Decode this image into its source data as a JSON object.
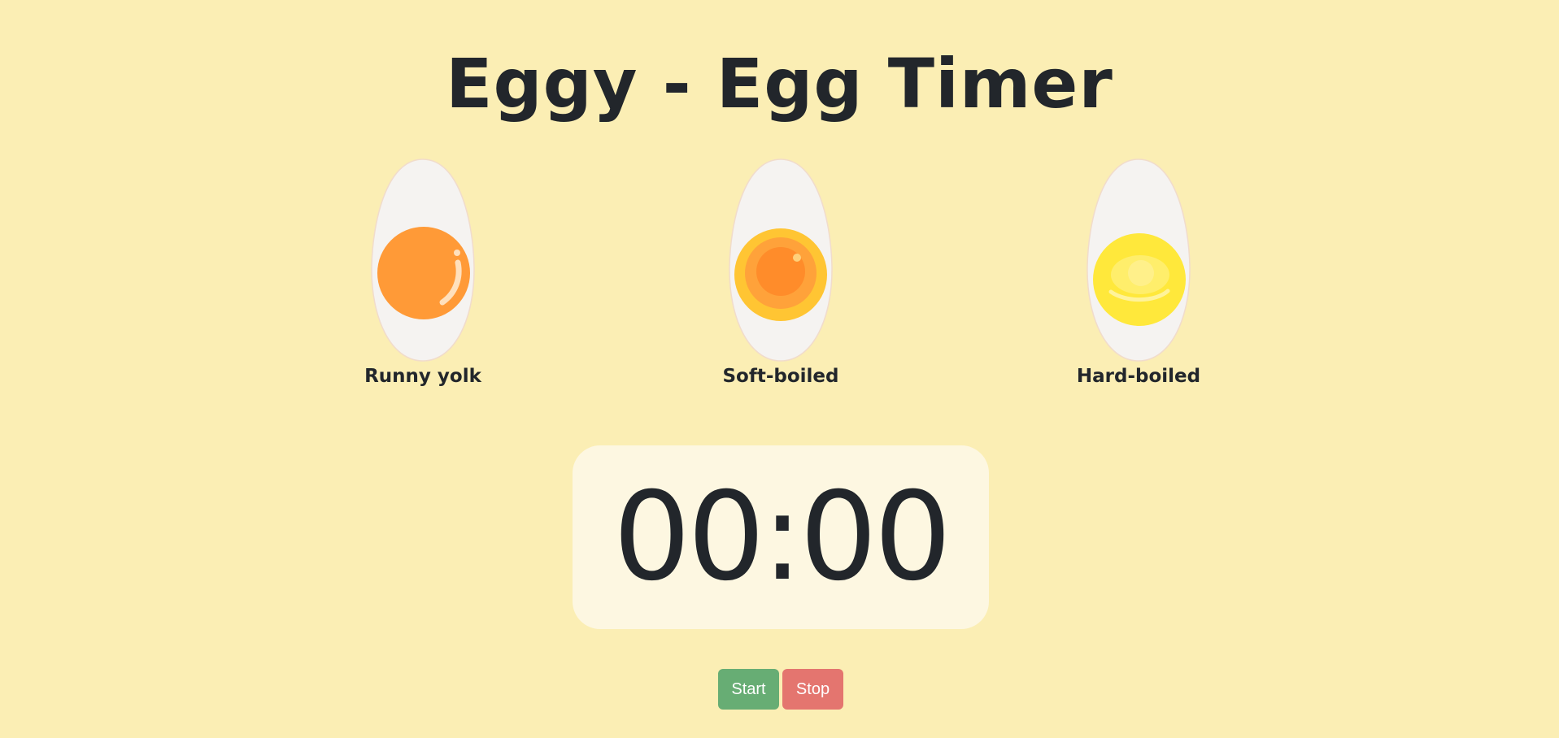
{
  "header": {
    "title": "Eggy - Egg Timer"
  },
  "eggs": [
    {
      "label": "Runny yolk",
      "icon": "runny-yolk-egg-icon",
      "yolk_color": "#FF9A37"
    },
    {
      "label": "Soft-boiled",
      "icon": "soft-boiled-egg-icon",
      "yolk_color": "#FFC533"
    },
    {
      "label": "Hard-boiled",
      "icon": "hard-boiled-egg-icon",
      "yolk_color": "#FFE83B"
    }
  ],
  "timer": {
    "display": "00:00"
  },
  "controls": {
    "start_label": "Start",
    "stop_label": "Stop"
  },
  "colors": {
    "background": "#FBEEB4",
    "timer_panel": "#FDF7E1",
    "text": "#22262B",
    "egg_white": "#F5F3F1",
    "start_button": "#67AD74",
    "stop_button": "#E4756F"
  }
}
